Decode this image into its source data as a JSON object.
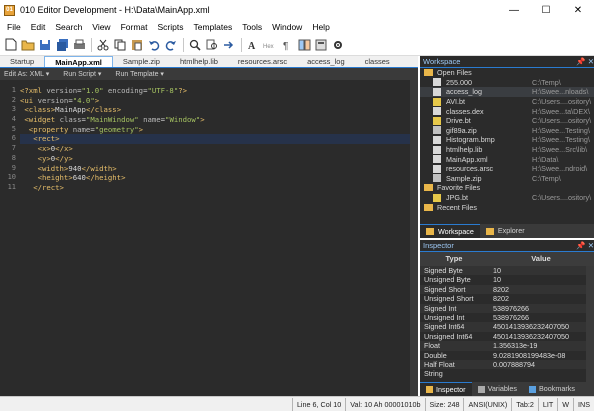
{
  "window": {
    "title": "010 Editor Development - H:\\Data\\MainApp.xml",
    "minimize": "—",
    "maximize": "☐",
    "close": "✕"
  },
  "menu": [
    "File",
    "Edit",
    "Search",
    "View",
    "Format",
    "Scripts",
    "Templates",
    "Tools",
    "Window",
    "Help"
  ],
  "toolbar": [
    "new-file-icon",
    "open-folder-icon",
    "save-icon",
    "save-all-icon",
    "print-icon",
    "cut-icon",
    "copy-icon",
    "paste-icon",
    "undo-icon",
    "redo-icon",
    "find-icon",
    "find-in-files-icon",
    "goto-icon",
    "text-mode-icon",
    "hex-mode-icon",
    "paragraph-icon",
    "compare-icon",
    "calculator-icon",
    "settings-icon"
  ],
  "tabs": [
    "Startup",
    "MainApp.xml",
    "Sample.zip",
    "htmlhelp.lib",
    "resources.arsc",
    "access_log",
    "classes"
  ],
  "editor_toolbar": [
    "Edit As: XML ▾",
    "Run Script ▾",
    "Run Template ▾"
  ],
  "editor": {
    "line_numbers": [
      "1",
      "2",
      "3",
      "4",
      "5",
      "6",
      "7",
      "8",
      "9",
      "10",
      "11"
    ],
    "highlight_line": 6,
    "lines": [
      [
        [
          "<?",
          "#e8bf6a"
        ],
        [
          "xml ",
          "#e8bf6a"
        ],
        [
          "version",
          "#bababa"
        ],
        [
          "=",
          "#d8d8d8"
        ],
        [
          "\"1.0\" ",
          "#a5c261"
        ],
        [
          "encoding",
          "#bababa"
        ],
        [
          "=",
          "#d8d8d8"
        ],
        [
          "\"UTF-8\"",
          "#a5c261"
        ],
        [
          "?>",
          "#e8bf6a"
        ]
      ],
      [
        [
          "<ui ",
          "#e8bf6a"
        ],
        [
          "version",
          "#bababa"
        ],
        [
          "=",
          "#d8d8d8"
        ],
        [
          "\"4.0\"",
          "#a5c261"
        ],
        [
          ">",
          "#e8bf6a"
        ]
      ],
      [
        [
          " ",
          "#d8d8d8"
        ],
        [
          "<class>",
          "#e8bf6a"
        ],
        [
          "MainApp",
          "#d8d8d8"
        ],
        [
          "</class>",
          "#e8bf6a"
        ]
      ],
      [
        [
          " ",
          "#d8d8d8"
        ],
        [
          "<widget ",
          "#e8bf6a"
        ],
        [
          "class",
          "#bababa"
        ],
        [
          "=",
          "#d8d8d8"
        ],
        [
          "\"MainWindow\" ",
          "#a5c261"
        ],
        [
          "name",
          "#bababa"
        ],
        [
          "=",
          "#d8d8d8"
        ],
        [
          "\"Window\"",
          "#a5c261"
        ],
        [
          ">",
          "#e8bf6a"
        ]
      ],
      [
        [
          "  ",
          "#d8d8d8"
        ],
        [
          "<property ",
          "#e8bf6a"
        ],
        [
          "name",
          "#bababa"
        ],
        [
          "=",
          "#d8d8d8"
        ],
        [
          "\"geometry\"",
          "#a5c261"
        ],
        [
          ">",
          "#e8bf6a"
        ]
      ],
      [
        [
          "   ",
          "#d8d8d8"
        ],
        [
          "<rect>",
          "#e8bf6a"
        ]
      ],
      [
        [
          "    ",
          "#d8d8d8"
        ],
        [
          "<x>",
          "#e8bf6a"
        ],
        [
          "0",
          "#d8d8d8"
        ],
        [
          "</x>",
          "#e8bf6a"
        ]
      ],
      [
        [
          "    ",
          "#d8d8d8"
        ],
        [
          "<y>",
          "#e8bf6a"
        ],
        [
          "0",
          "#d8d8d8"
        ],
        [
          "</y>",
          "#e8bf6a"
        ]
      ],
      [
        [
          "    ",
          "#d8d8d8"
        ],
        [
          "<width>",
          "#e8bf6a"
        ],
        [
          "940",
          "#d8d8d8"
        ],
        [
          "</width>",
          "#e8bf6a"
        ]
      ],
      [
        [
          "    ",
          "#d8d8d8"
        ],
        [
          "<height>",
          "#e8bf6a"
        ],
        [
          "640",
          "#d8d8d8"
        ],
        [
          "</height>",
          "#e8bf6a"
        ]
      ],
      [
        [
          "   ",
          "#d8d8d8"
        ],
        [
          "</rect>",
          "#e8bf6a"
        ]
      ]
    ]
  },
  "workspace": {
    "title": "Workspace",
    "pin": "📌 ✕",
    "open_files_label": "Open Files",
    "open_files": [
      {
        "name": "255.000",
        "path": "C:\\Temp\\",
        "icon": "#d8d8d8"
      },
      {
        "name": "access_log",
        "path": "H:\\Swee...nloads\\",
        "icon": "#d8d8d8",
        "selected": true
      },
      {
        "name": "AVI.bt",
        "path": "C:\\Users....ository\\",
        "icon": "#e6c84a"
      },
      {
        "name": "classes.dex",
        "path": "H:\\Swee...ta\\DEX\\",
        "icon": "#d8d8d8"
      },
      {
        "name": "Drive.bt",
        "path": "C:\\Users....ository\\",
        "icon": "#e6c84a"
      },
      {
        "name": "gif89a.zip",
        "path": "H:\\Swee...Testing\\",
        "icon": "#c0c0c0"
      },
      {
        "name": "Histogram.bmp",
        "path": "H:\\Swee...Testing\\",
        "icon": "#d8d8d8"
      },
      {
        "name": "htmlhelp.lib",
        "path": "H:\\Swee...Src\\lib\\",
        "icon": "#d8d8d8"
      },
      {
        "name": "MainApp.xml",
        "path": "H:\\Data\\",
        "icon": "#d8d8d8"
      },
      {
        "name": "resources.arsc",
        "path": "H:\\Swee...ndroid\\",
        "icon": "#d8d8d8"
      },
      {
        "name": "Sample.zip",
        "path": "C:\\Temp\\",
        "icon": "#c0c0c0"
      }
    ],
    "favorites_label": "Favorite Files",
    "favorites": [
      {
        "name": "JPG.bt",
        "path": "C:\\Users....ository\\",
        "icon": "#e6c84a"
      }
    ],
    "recent_label": "Recent Files",
    "tabs": [
      "Workspace",
      "Explorer"
    ]
  },
  "inspector": {
    "title": "Inspector",
    "pin": "📌 ✕",
    "col_type": "Type",
    "col_value": "Value",
    "rows": [
      [
        "Signed Byte",
        "10"
      ],
      [
        "Unsigned Byte",
        "10"
      ],
      [
        "Signed Short",
        "8202"
      ],
      [
        "Unsigned Short",
        "8202"
      ],
      [
        "Signed Int",
        "538976266"
      ],
      [
        "Unsigned Int",
        "538976266"
      ],
      [
        "Signed Int64",
        "4501413936232407050"
      ],
      [
        "Unsigned Int64",
        "4501413936232407050"
      ],
      [
        "Float",
        "1.356313e-19"
      ],
      [
        "Double",
        "9.0281908199483e-08"
      ],
      [
        "Half Float",
        "0.007888794"
      ],
      [
        "String",
        ""
      ]
    ],
    "tabs": [
      "Inspector",
      "Variables",
      "Bookmarks"
    ]
  },
  "status": [
    "Line 6, Col 10",
    "Val: 10 Ah 00001010b",
    "Size: 248",
    "ANSI(UNIX)",
    "Tab:2",
    "LIT",
    "W",
    "INS"
  ]
}
